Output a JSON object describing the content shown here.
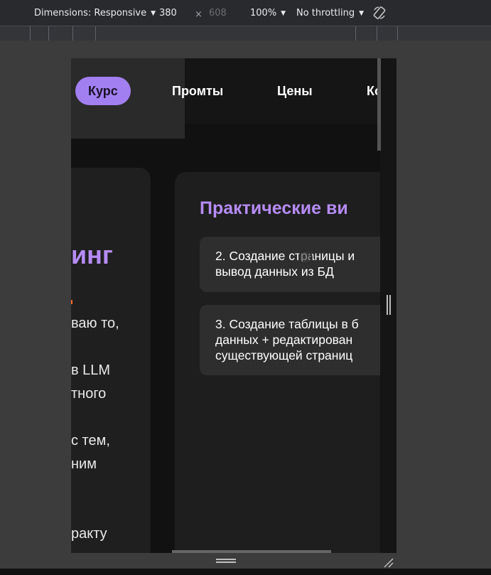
{
  "toolbar": {
    "dimensions_label": "Dimensions: Responsive",
    "width_value": "380",
    "times": "×",
    "height_value": "608",
    "zoom_label": "100%",
    "throttle_label": "No throttling",
    "rotate_icon": "rotate-icon"
  },
  "nav": {
    "items": [
      {
        "label": "Курс",
        "active": true
      },
      {
        "label": "Промты"
      },
      {
        "label": "Цены"
      },
      {
        "label": "Ко"
      }
    ]
  },
  "left_card": {
    "heading": "инг",
    "lines": [
      "ваю то,",
      "в LLM",
      "тного",
      "с тем,",
      "ним",
      "ракту"
    ]
  },
  "right_card": {
    "title": "Практические ви",
    "videos": [
      {
        "lines": [
          "2. Создание страницы и",
          "вывод данных из БД"
        ]
      },
      {
        "lines": [
          "3. Создание таблицы в б",
          "данных + редактирован",
          "существующей страниц"
        ]
      }
    ]
  },
  "colors": {
    "accent": "#a27ff0",
    "heading": "#b58cf5",
    "card": "#1e1e1e",
    "background": "#111111"
  }
}
